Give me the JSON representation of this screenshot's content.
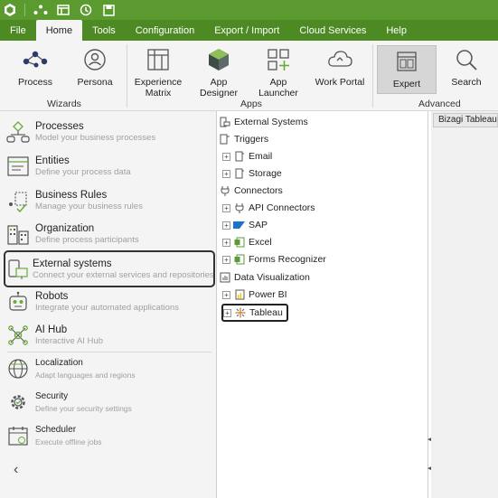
{
  "menu": {
    "items": [
      "File",
      "Home",
      "Tools",
      "Configuration",
      "Export / Import",
      "Cloud Services",
      "Help"
    ],
    "active": "Home"
  },
  "ribbon": {
    "wizards": {
      "label": "Wizards",
      "process": "Process",
      "persona": "Persona"
    },
    "apps": {
      "label": "Apps",
      "experience_matrix_1": "Experience",
      "experience_matrix_2": "Matrix",
      "app_designer": "App Designer",
      "app_launcher": "App Launcher",
      "work_portal": "Work Portal"
    },
    "advanced": {
      "label": "Advanced",
      "expert": "Expert",
      "search": "Search"
    }
  },
  "nav": {
    "processes": {
      "title": "Processes",
      "subtitle": "Model your business processes"
    },
    "entities": {
      "title": "Entities",
      "subtitle": "Define your process data"
    },
    "business_rules": {
      "title": "Business Rules",
      "subtitle": "Manage your business rules"
    },
    "organization": {
      "title": "Organization",
      "subtitle": "Define process participants"
    },
    "external_systems": {
      "title": "External systems",
      "subtitle": "Connect your external services and repositories"
    },
    "robots": {
      "title": "Robots",
      "subtitle": "Integrate your automated applications"
    },
    "ai_hub": {
      "title": "AI Hub",
      "subtitle": "Interactive AI Hub"
    },
    "localization": {
      "title": "Localization",
      "subtitle": "Adapt languages and regions"
    },
    "security": {
      "title": "Security",
      "subtitle": "Define your security settings"
    },
    "scheduler": {
      "title": "Scheduler",
      "subtitle": "Execute offline jobs"
    },
    "collapse_glyph": "‹"
  },
  "tree": {
    "root": "External Systems",
    "triggers": "Triggers",
    "email": "Email",
    "storage": "Storage",
    "connectors": "Connectors",
    "api_connectors": "API Connectors",
    "sap": "SAP",
    "excel": "Excel",
    "forms_recognizer": "Forms Recognizer",
    "data_visualization": "Data Visualization",
    "power_bi": "Power BI",
    "tableau": "Tableau",
    "expand_glyph": "+"
  },
  "right": {
    "tab_title": "Bizagi Tableau"
  },
  "colors": {
    "titlebar": "#5b9a2e",
    "menubar": "#4d8a24",
    "accent_green": "#6aab3a"
  }
}
